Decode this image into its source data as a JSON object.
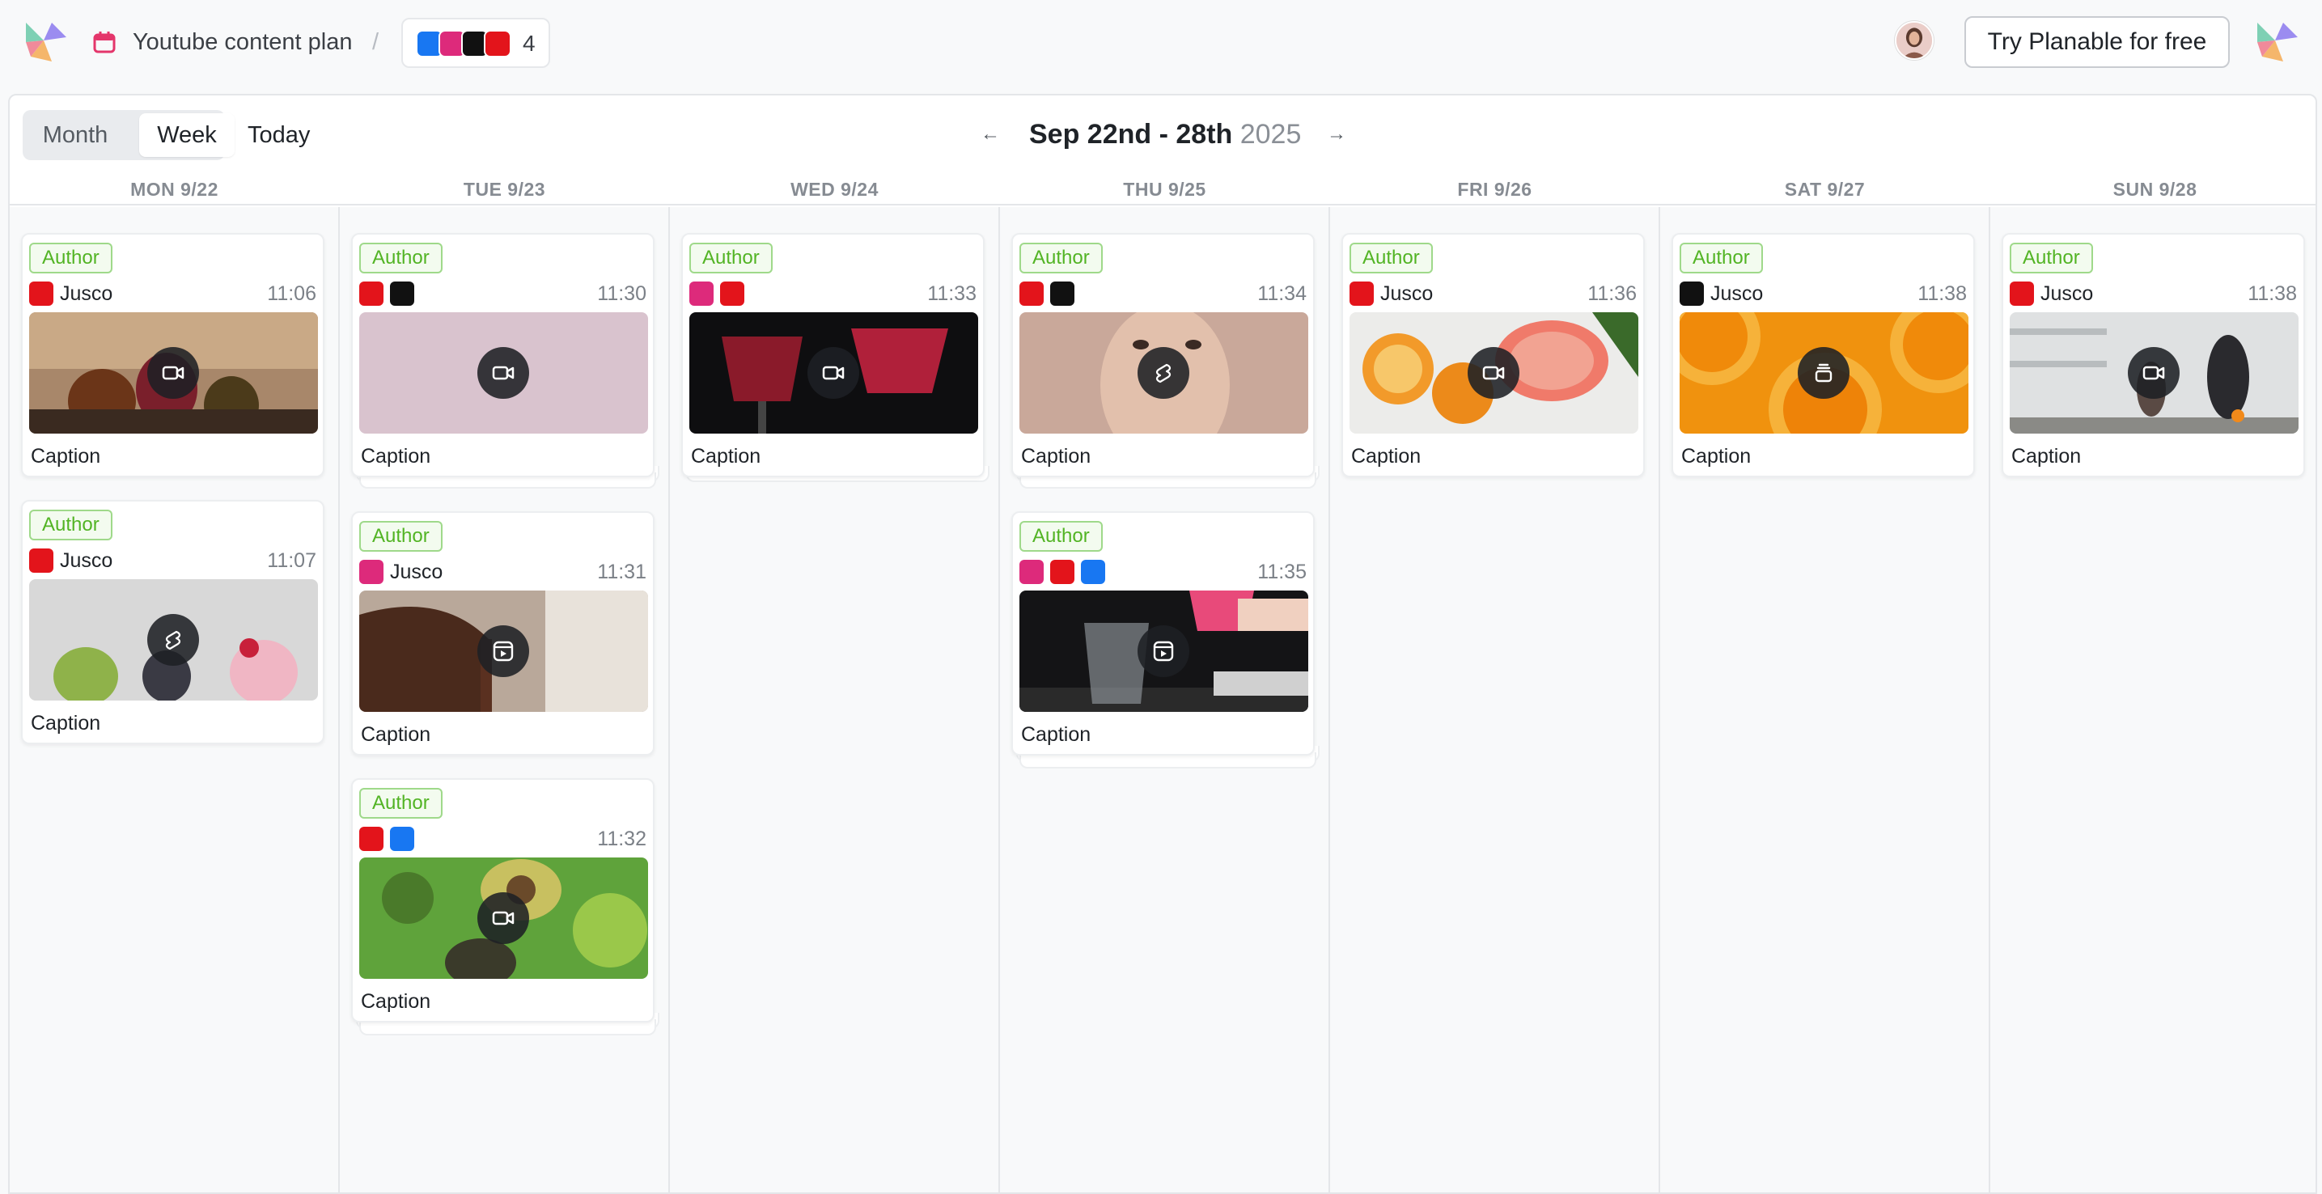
{
  "header": {
    "workspace_title": "Youtube content plan",
    "separator": "/",
    "channel_count": "4",
    "cta_label": "Try Planable for free"
  },
  "toolbar": {
    "view_month": "Month",
    "view_week": "Week",
    "today": "Today",
    "prev_arrow": "←",
    "next_arrow": "→",
    "range_main": "Sep 22nd - 28th",
    "range_year": "2025"
  },
  "days": [
    "MON 9/22",
    "TUE 9/23",
    "WED 9/24",
    "THU 9/25",
    "FRI 9/26",
    "SAT 9/27",
    "SUN 9/28"
  ],
  "posts": [
    {
      "day": 0,
      "author": "Author",
      "networks": [
        "youtube"
      ],
      "account": "Jusco",
      "time": "11:06",
      "media": "video-icon",
      "caption": "Caption"
    },
    {
      "day": 0,
      "author": "Author",
      "networks": [
        "youtube"
      ],
      "account": "Jusco",
      "time": "11:07",
      "media": "shorts-icon",
      "caption": "Caption"
    },
    {
      "day": 1,
      "author": "Author",
      "networks": [
        "youtube",
        "tiktok"
      ],
      "account": "",
      "time": "11:30",
      "media": "video-icon",
      "caption": "Caption"
    },
    {
      "day": 1,
      "author": "Author",
      "networks": [
        "instagram"
      ],
      "account": "Jusco",
      "time": "11:31",
      "media": "reels-icon",
      "caption": "Caption"
    },
    {
      "day": 1,
      "author": "Author",
      "networks": [
        "youtube",
        "facebook"
      ],
      "account": "",
      "time": "11:32",
      "media": "video-icon",
      "caption": "Caption"
    },
    {
      "day": 2,
      "author": "Author",
      "networks": [
        "instagram",
        "youtube"
      ],
      "account": "",
      "time": "11:33",
      "media": "video-icon",
      "caption": "Caption"
    },
    {
      "day": 3,
      "author": "Author",
      "networks": [
        "youtube",
        "tiktok"
      ],
      "account": "",
      "time": "11:34",
      "media": "shorts-icon",
      "caption": "Caption"
    },
    {
      "day": 3,
      "author": "Author",
      "networks": [
        "instagram",
        "youtube",
        "facebook"
      ],
      "account": "",
      "time": "11:35",
      "media": "reels-icon",
      "caption": "Caption"
    },
    {
      "day": 4,
      "author": "Author",
      "networks": [
        "youtube"
      ],
      "account": "Jusco",
      "time": "11:36",
      "media": "video-icon",
      "caption": "Caption"
    },
    {
      "day": 5,
      "author": "Author",
      "networks": [
        "tiktok"
      ],
      "account": "Jusco",
      "time": "11:38",
      "media": "stack-icon",
      "caption": "Caption"
    },
    {
      "day": 6,
      "author": "Author",
      "networks": [
        "youtube"
      ],
      "account": "Jusco",
      "time": "11:38",
      "media": "video-icon",
      "caption": "Caption"
    }
  ],
  "colors": {
    "youtube": "#e3141b",
    "instagram": "#dd2a7b",
    "tiktok": "#111111",
    "facebook": "#1877f2",
    "author_green": "#52b424"
  }
}
